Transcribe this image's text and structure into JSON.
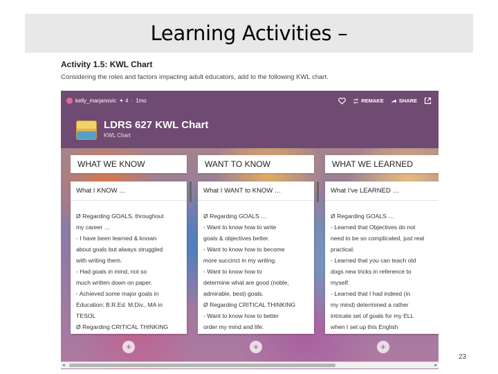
{
  "slide": {
    "title": "Learning Activities –",
    "page_number": "23"
  },
  "activity": {
    "title": "Activity 1.5: KWL Chart",
    "description": "Considering the roles and factors impacting adult educators, add to the following KWL chart."
  },
  "board": {
    "author": "kelly_marjanovic",
    "likes": "✦ 4",
    "separator": "·",
    "age": "1mo",
    "remake_label": "REMAKE",
    "share_label": "SHARE",
    "title": "LDRS 627 KWL Chart",
    "subtitle": "KWL Chart"
  },
  "columns": [
    {
      "header": "WHAT WE KNOW",
      "card_title": "What I KNOW …",
      "lines": [
        "Ø  Regarding GOALS, throughout",
        "my career …",
        "-      I have been learned & known",
        "about goals but always struggled",
        "with writing them.",
        "-      Had goals in mind, not so",
        "much written down on paper.",
        "-      Achieved some major goals in",
        "Education: B.R.Ed. M.Div., MA in",
        "TESOL",
        "Ø  Regarding CRITICAL THINKING"
      ]
    },
    {
      "header": "WANT TO KNOW",
      "card_title": "What I WANT to KNOW …",
      "lines": [
        "Ø  Regarding GOALS …",
        "-      Want to know how to write",
        "goals & objectives better.",
        "-      Want to know how to become",
        "more succinct in my writing.",
        "-      Want to know how to",
        "determine what are good (noble,",
        "admirable, best) goals.",
        "Ø  Regarding CRITICAL THINKING",
        "-      Want to know how to better",
        "order my mind and life."
      ]
    },
    {
      "header": "WHAT WE LEARNED",
      "card_title": "What I've LEARNED …",
      "lines": [
        "Ø  Regarding GOALS …",
        "-      Learned that Objectives do not",
        "need to be so complicated, just real",
        "practical.",
        "-      Learned that you can teach old",
        "dogs new tricks in reference to",
        "myself.",
        "-      Learned that I had indeed (in",
        "my mind) determined a rather",
        "intricate set of goals for my ELL",
        "when I set up this English"
      ]
    }
  ],
  "add_label": "+",
  "colors": {
    "header_bg": "#6f4a72",
    "title_bar_bg": "#e8e8e8"
  }
}
